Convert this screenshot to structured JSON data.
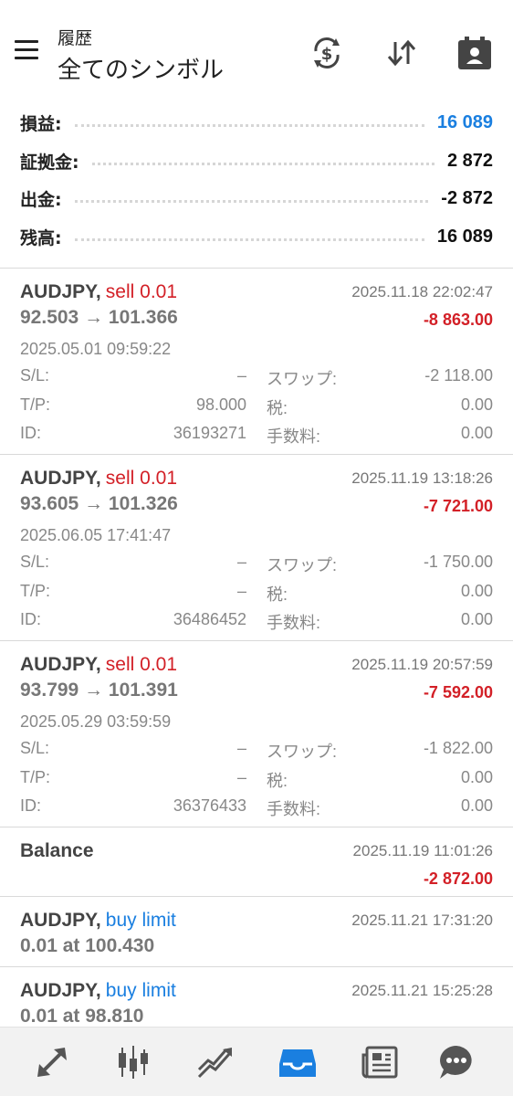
{
  "header": {
    "subtitle": "履歴",
    "title": "全てのシンボル",
    "icons": [
      "menu-icon",
      "currency-exchange-icon",
      "sort-icon",
      "calendar-person-icon"
    ]
  },
  "summary": [
    {
      "label": "損益:",
      "value": "16 089",
      "color": "#1a7fe0"
    },
    {
      "label": "証拠金:",
      "value": "2 872"
    },
    {
      "label": "出金:",
      "value": "-2 872"
    },
    {
      "label": "残高:",
      "value": "16 089"
    }
  ],
  "trades": [
    {
      "symbol": "AUDJPY,",
      "side": "sell 0.01",
      "close_time": "2025.11.18 22:02:47",
      "prices": "92.503 → 101.366",
      "profit": "-8 863.00",
      "open_time": "2025.05.01 09:59:22",
      "sl_label": "S/L:",
      "sl": "–",
      "swap_label": "スワップ:",
      "swap": "-2 118.00",
      "tp_label": "T/P:",
      "tp": "98.000",
      "tax_label": "税:",
      "tax": "0.00",
      "id_label": "ID:",
      "id": "36193271",
      "fee_label": "手数料:",
      "fee": "0.00"
    },
    {
      "symbol": "AUDJPY,",
      "side": "sell 0.01",
      "close_time": "2025.11.19 13:18:26",
      "prices": "93.605 → 101.326",
      "profit": "-7 721.00",
      "open_time": "2025.06.05 17:41:47",
      "sl_label": "S/L:",
      "sl": "–",
      "swap_label": "スワップ:",
      "swap": "-1 750.00",
      "tp_label": "T/P:",
      "tp": "–",
      "tax_label": "税:",
      "tax": "0.00",
      "id_label": "ID:",
      "id": "36486452",
      "fee_label": "手数料:",
      "fee": "0.00"
    },
    {
      "symbol": "AUDJPY,",
      "side": "sell 0.01",
      "close_time": "2025.11.19 20:57:59",
      "prices": "93.799 → 101.391",
      "profit": "-7 592.00",
      "open_time": "2025.05.29 03:59:59",
      "sl_label": "S/L:",
      "sl": "–",
      "swap_label": "スワップ:",
      "swap": "-1 822.00",
      "tp_label": "T/P:",
      "tp": "–",
      "tax_label": "税:",
      "tax": "0.00",
      "id_label": "ID:",
      "id": "36376433",
      "fee_label": "手数料:",
      "fee": "0.00"
    }
  ],
  "balance": {
    "label": "Balance",
    "time": "2025.11.19 11:01:26",
    "amount": "-2 872.00"
  },
  "orders": [
    {
      "symbol": "AUDJPY,",
      "side": "buy limit",
      "time": "2025.11.21 17:31:20",
      "price": "0.01 at 100.430"
    },
    {
      "symbol": "AUDJPY,",
      "side": "buy limit",
      "time": "2025.11.21 15:25:28",
      "price": "0.01 at 98.810"
    }
  ],
  "bottom_nav": [
    "quotes-icon",
    "chart-icon",
    "trade-icon",
    "history-icon",
    "news-icon",
    "chat-icon"
  ],
  "colors": {
    "accent": "#1a7fe0",
    "loss": "#d32027",
    "active_tab": "#1a7fe0"
  }
}
